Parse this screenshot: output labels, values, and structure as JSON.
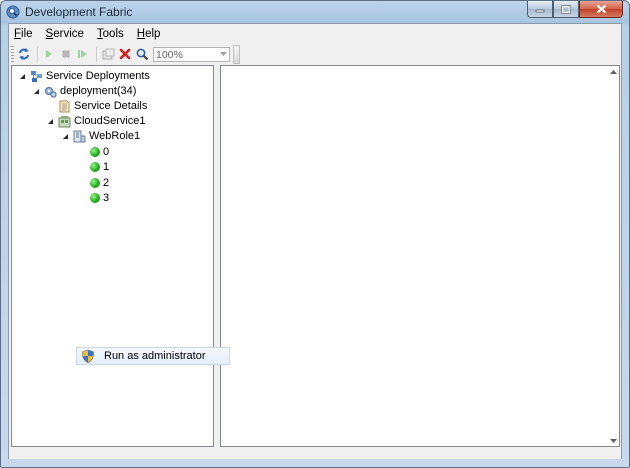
{
  "window": {
    "title": "Development Fabric"
  },
  "menu": [
    {
      "label": "File",
      "key": "F",
      "rest": "ile"
    },
    {
      "label": "Service",
      "key": "S",
      "rest": "ervice"
    },
    {
      "label": "Tools",
      "key": "T",
      "rest": "ools"
    },
    {
      "label": "Help",
      "key": "H",
      "rest": "elp"
    }
  ],
  "toolbar": {
    "zoom_value": "100%"
  },
  "tree": {
    "root": "Service Deployments",
    "deployment": "deployment(34)",
    "service_details": "Service Details",
    "cloud_service": "CloudService1",
    "role": "WebRole1",
    "instances": [
      "0",
      "1",
      "2",
      "3"
    ]
  },
  "context_menu": {
    "item": "Run as administrator"
  },
  "icons": {
    "refresh": "refresh-icon",
    "run": "run-icon",
    "stop": "stop-icon",
    "step": "step-icon",
    "attach": "attach-icon",
    "delete": "delete-icon",
    "zoom": "magnifier-icon",
    "shield": "uac-shield-icon"
  },
  "colors": {
    "running": "#20b020",
    "delete": "#d02020",
    "titlebar": "#bcd3ea"
  }
}
